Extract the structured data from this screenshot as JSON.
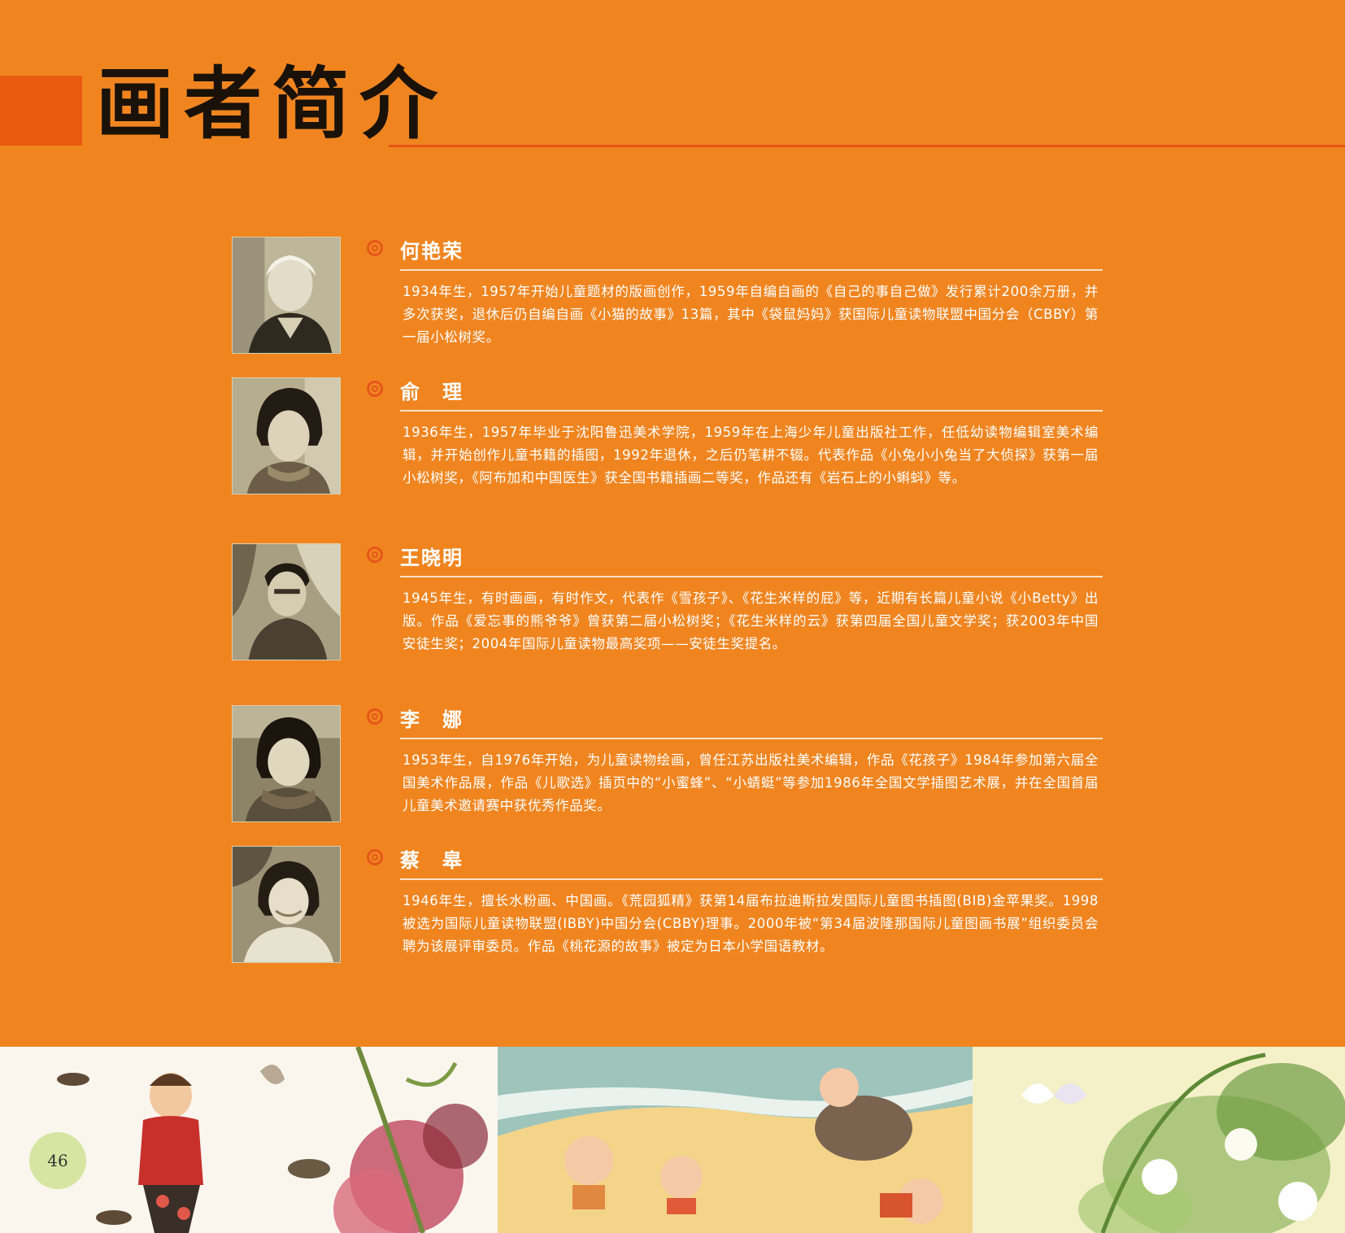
{
  "page_title": "画者简介",
  "artists": [
    {
      "name": "何艳荣",
      "bio": "1934年生，1957年开始儿童题材的版画创作，1959年自编自画的《自己的事自己做》发行累计200余万册，并多次获奖，退休后仍自编自画《小猫的故事》13篇，其中《袋鼠妈妈》获国际儿童读物联盟中国分会（CBBY）第一届小松树奖。"
    },
    {
      "name": "俞　理",
      "bio": "1936年生，1957年毕业于沈阳鲁迅美术学院，1959年在上海少年儿童出版社工作，任低幼读物编辑室美术编辑，并开始创作儿童书籍的插图，1992年退休，之后仍笔耕不辍。代表作品《小兔小小兔当了大侦探》获第一届小松树奖，《阿布加和中国医生》获全国书籍插画二等奖，作品还有《岩石上的小蝌蚪》等。"
    },
    {
      "name": "王晓明",
      "bio": "1945年生，有时画画，有时作文，代表作《雪孩子》、《花生米样的屁》等，近期有长篇儿童小说《小Betty》出版。作品《爱忘事的熊爷爷》曾获第二届小松树奖；《花生米样的云》获第四届全国儿童文学奖；获2003年中国安徒生奖；2004年国际儿童读物最高奖项——安徒生奖提名。"
    },
    {
      "name": "李　娜",
      "bio": "1953年生，自1976年开始，为儿童读物绘画，曾任江苏出版社美术编辑，作品《花孩子》1984年参加第六届全国美术作品展，作品《儿歌选》插页中的“小蜜蜂”、“小蜻蜓”等参加1986年全国文学插图艺术展，并在全国首届儿童美术邀请赛中获优秀作品奖。"
    },
    {
      "name": "蔡　皋",
      "bio": "1946年生，擅长水粉画、中国画。《荒园狐精》获第14届布拉迪斯拉发国际儿童图书插图(BIB)金苹果奖。1998被选为国际儿童读物联盟(IBBY)中国分会(CBBY)理事。2000年被“第34届波隆那国际儿童图画书展”组织委员会聘为该展评审委员。作品《桃花源的故事》被定为日本小学国语教材。"
    }
  ],
  "page_number": "46",
  "colors": {
    "background": "#f08520",
    "accent": "#e6561a",
    "text": "#ffffff",
    "title": "#1a1208"
  }
}
